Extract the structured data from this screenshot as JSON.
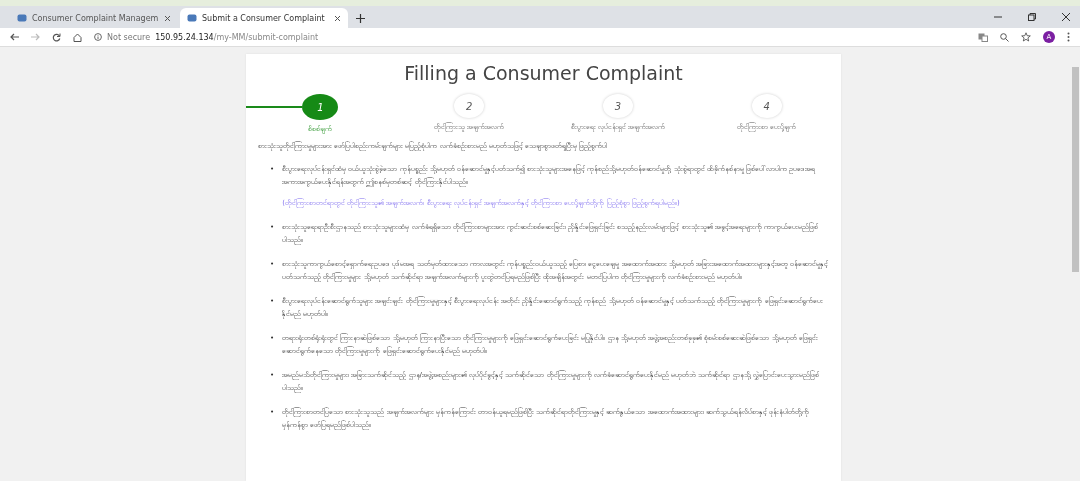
{
  "browser": {
    "tabs": [
      {
        "title": "Consumer Complaint Managem",
        "selected": false
      },
      {
        "title": "Submit a Consumer Complaint",
        "selected": true
      }
    ],
    "security": "Not secure",
    "url_host": "150.95.24.134",
    "url_path": "/my-MM/submit-complaint",
    "avatar": "A"
  },
  "page": {
    "title": "Filling a Consumer Complaint",
    "steps": [
      {
        "number": "1",
        "label": "စိစစ်ချက်",
        "selected": true
      },
      {
        "number": "2",
        "label": "တိုင်ကြားသူ အချက်အလက်",
        "selected": false
      },
      {
        "number": "3",
        "label": "စီးပွားရေး လုပ်ငန်းရှင် အချက်အလက်",
        "selected": false
      },
      {
        "number": "4",
        "label": "တိုင်ကြားစာ ပေးပို့ချက်",
        "selected": false
      }
    ],
    "intro": "စားသုံးသူတိုင်ကြားမှုများအား ဖော်ပြပါစည်းကမ်းချက်များ မပြည့်စုံပါက လက်ခံစဉ်းစားမည် မဟုတ်သဖြင့် သေချာစွာဖတ်ရှုပြီးမှ ဖြည့်စွက်ပါ",
    "rules": [
      {
        "bullet": "•",
        "text": "စီးပွားရေးလုပ်ငန်းရှင်ထံမှ ဝယ်ယူသုံးစွဲခဲ့သော ကုန်ပစ္စည်း သို့မဟုတ် ဝန်ဆောင်မှုနှင့်ပတ်သက်၍ စားသုံးသူများအနေဖြင့် ကုန်စည်သို့မဟုတ်ဝန်ဆောင်မှုတို့ သုံးစွဲရာတွင် ထိခိုက်နစ်နာမှု ဖြစ်ပေါ်လာပါက ဥပဒေအရ အကာအကွယ်ပေးနိုင်ရန်အတွက် ဤစနစ်မှတစ်ဆင့် တိုင်ကြားနိုင်ပါသည်။",
        "note": "(တိုင်ကြားစာတင်ရာတွင် တိုင်ကြားသူ၏ အချက်အလက်၊ စီးပွားရေး လုပ်ငန်းရှင် အချက်အလက်နှင့် တိုင်ကြားစာ ပေးပို့ချက်တို့ကို ပြည့်စုံစွာ ဖြည့်စွက်ရပါမည်။)"
      },
      {
        "bullet": "•",
        "text": "စားသုံးသူရေးရာဦးစီးဌာနသည် စားသုံးသူများထံမှ လက်ခံရရှိသော တိုင်ကြားစာများအား ကွင်းဆင်းစစ်ဆေးခြင်း၊ ညှိနှိုင်းဖြေရှင်းခြင်း စသည့်နည်းလမ်းများဖြင့် စားသုံးသူ၏ အခွင့်အရေးများကို ကာကွယ်ပေးမည်ဖြစ်ပါသည်။"
      },
      {
        "bullet": "•",
        "text": "စားသုံးသူကာကွယ်စောင့်ရှောက်ရေးဥပဒေ ပုဒ်မအရ သတ်မှတ်ထားသော ကာလအတွင်း ကုန်ပစ္စည်းဝယ်ယူသည့် ပြေစာ၊ ငွေပေးချေမှု အထောက်အထား သို့မဟုတ် အခြားအထောက်အထားများနှင့်အတူ ဝန်ဆောင်မှုနှင့် ပတ်သက်သည့် တိုင်ကြားမှုများ သို့မဟုတ် သက်ဆိုင်ရာ အချက်အလက်များကို ပူးတွဲတင်ပြရမည်ဖြစ်ပြီး ထိုအချိန်အတွင်း မတင်ပြပါက တိုင်ကြားမှုများကို လက်ခံစဉ်းစားမည် မဟုတ်ပါ။"
      },
      {
        "bullet": "•",
        "text": "စီးပွားရေးလုပ်ငန်းဆောင်ရွက်သူများ အချင်းချင်း တိုင်ကြားမှုများနှင့် စီးပွားရေးလုပ်ငန်း အတိုင်း ညှိနှိုင်းဆောင်ရွက်သည့် ကုန်စည် သို့မဟုတ် ဝန်ဆောင်မှုနှင့် ပတ်သက်သည့် တိုင်ကြားမှုများကို ဖြေရှင်းဆောင်ရွက်ပေးနိုင်မည် မဟုတ်ပါ။"
      },
      {
        "bullet": "•",
        "text": "တရားရုံးတစ်ရုံးရုံးတွင် ကြားနာဆဲဖြစ်သော သို့မဟုတ် ကြားနာပြီးသော တိုင်ကြားမှုများကို ဖြေရှင်းဆောင်ရွက်ပေးခြင်း မပြုနိုင်ပါ။ ဌာန သို့မဟုတ် အဖွဲ့အစည်းတစ်ခုခု၏ စုံစမ်းစစ်ဆေးဆဲဖြစ်သော သို့မဟုတ် ဖြေရှင်းဆောင်ရွက်နေသော တိုင်ကြားမှုများကို ဖြေရှင်းဆောင်ရွက်ပေးနိုင်မည် မဟုတ်ပါ။"
      },
      {
        "bullet": "•",
        "text": "အမည်မသိတိုင်ကြားမှုများ၊ အခြားသက်ဆိုင်သည့် ဌာန/အဖွဲ့အစည်းများ၏ လုပ်ပိုင်ခွင့်နှင့် သက်ဆိုင်သော တိုင်ကြားမှုများကို လက်ခံဆောင်ရွက်ပေးနိုင်မည် မဟုတ်ဘဲ သက်ဆိုင်ရာ ဌာနသို့ လွှဲပြောင်းပေးသွားမည်ဖြစ်ပါသည်။"
      },
      {
        "bullet": "•",
        "text": "တိုင်ကြားစာတင်ပြသော စားသုံးသူသည် အချက်အလက်များ မှန်ကန်ကြောင်း တာဝန်ယူရမည်ဖြစ်ပြီး သက်ဆိုင်ရာတိုင်ကြားမှုနှင့် ဆက်နွယ်သော အထောက်အထားများ၊ ဆက်သွယ်ရန်လိပ်စာနှင့် ဖုန်းနံပါတ်တို့ကို မှန်ကန်စွာ ဖော်ပြရမည်ဖြစ်ပါသည်။"
      }
    ]
  }
}
